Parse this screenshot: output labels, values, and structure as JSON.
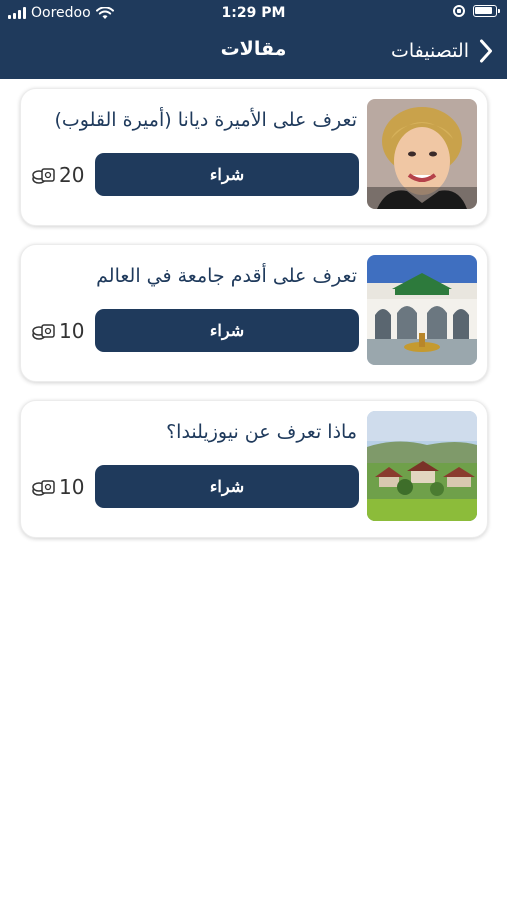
{
  "status_bar": {
    "carrier": "Ooredoo",
    "time": "1:29 PM"
  },
  "nav": {
    "title": "مقالات",
    "back_label": "التصنيفات"
  },
  "articles": [
    {
      "title": "تعرف على الأميرة ديانا (أميرة القلوب)",
      "buy_label": "شراء",
      "price": "20",
      "image": "portrait-photo"
    },
    {
      "title": "تعرف على أقدم جامعة في العالم",
      "buy_label": "شراء",
      "price": "10",
      "image": "university-courtyard-photo"
    },
    {
      "title": "ماذا تعرف عن نيوزيلندا؟",
      "buy_label": "شراء",
      "price": "10",
      "image": "countryside-landscape-photo"
    }
  ],
  "colors": {
    "primary": "#1f3a5c",
    "background": "#ffffff"
  }
}
